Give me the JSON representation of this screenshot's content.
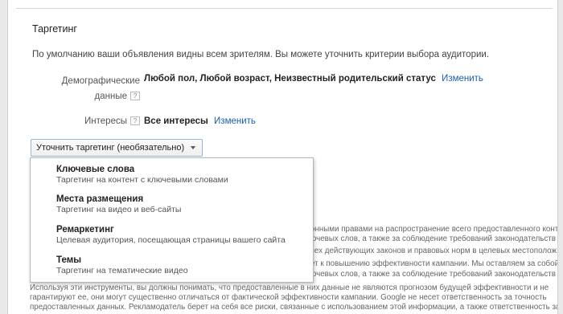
{
  "section": {
    "title": "Таргетинг"
  },
  "intro": "По умолчанию ваши объявления видны всем зрителям. Вы можете уточнить критерии выбора аудитории.",
  "demographics": {
    "label_line1": "Демографические",
    "label_line2": "данные",
    "help": "?",
    "value": "Любой пол, Любой возраст, Неизвестный родительский статус",
    "link": "Изменить"
  },
  "interests": {
    "label": "Интересы",
    "help": "?",
    "value": "Все интересы",
    "link": "Изменить"
  },
  "refine_button": {
    "label": "Уточнить таргетинг (необязательно)"
  },
  "menu": {
    "items": [
      {
        "title": "Ключевые слова",
        "desc": "Таргетинг на контент с ключевыми словами"
      },
      {
        "title": "Места размещения",
        "desc": "Таргетинг на видео и веб-сайты"
      },
      {
        "title": "Ремаркетинг",
        "desc": "Целевая аудитория, посещающая страницы вашего сайта"
      },
      {
        "title": "Темы",
        "desc": "Таргетинг на тематические видео"
      }
    ]
  },
  "background_text": {
    "r1": "онными правами на распространение всего предоставленного конте",
    "r2": "ючевых слов, а также за соблюдение требований законодательств",
    "r3": "сех действующих законов и правовых норм в целевых местополож",
    "r4": "ет к повышению эффективности кампании. Мы оставляем за собой",
    "r5": "ючевых слов, а также за соблюдение требований законодательств",
    "l1": "Используя эти инструменты, вы должны понимать, что предоставленные в них данные не являются прогнозом будущей эффективности и не",
    "l2": "гарантируют ее, они могут существенно отличаться от фактической эффективности кампании. Google не несет ответственность за точность",
    "l3": "предоставленных данных. Рекламодатель берет на себя все риски, связанные с использованием этой информации, а также ответственность за"
  }
}
